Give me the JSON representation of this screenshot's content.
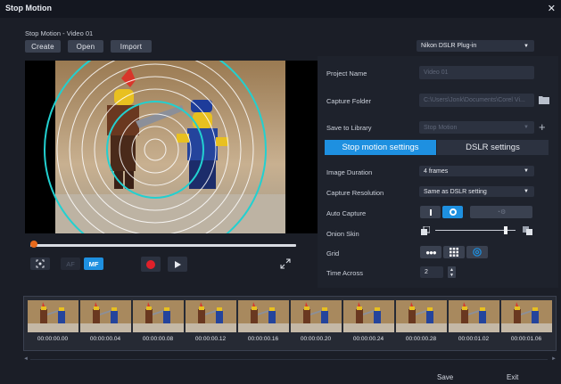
{
  "window": {
    "title": "Stop Motion",
    "subtitle": "Stop Motion - Video 01"
  },
  "toolbar": {
    "create": "Create",
    "open": "Open",
    "import": "Import"
  },
  "plugin_select": "Nikon DSLR Plug-in",
  "fields": {
    "project_name_label": "Project Name",
    "project_name_value": "Video 01",
    "capture_folder_label": "Capture Folder",
    "capture_folder_value": "C:\\Users\\Jonk\\Documents\\Corel Vi...",
    "save_library_label": "Save to Library",
    "save_library_value": "Stop Motion"
  },
  "tabs": {
    "stop_motion": "Stop motion settings",
    "dslr": "DSLR settings"
  },
  "settings": {
    "image_duration_label": "Image Duration",
    "image_duration_value": "4 frames",
    "capture_resolution_label": "Capture Resolution",
    "capture_resolution_value": "Same as DSLR setting",
    "auto_capture_label": "Auto Capture",
    "onion_skin_label": "Onion Skin",
    "grid_label": "Grid",
    "time_across_label": "Time Across",
    "time_across_value": "2",
    "onion_skin_level": 0.88
  },
  "playback": {
    "af": "AF",
    "mf": "MF",
    "progress": 0.0
  },
  "timeline": {
    "timecodes": [
      "00:00:00.00",
      "00:00:00.04",
      "00:00:00.08",
      "00:00:00.12",
      "00:00:00.16",
      "00:00:00.20",
      "00:00:00.24",
      "00:00:00.28",
      "00:00:01.02",
      "00:00:01.06"
    ]
  },
  "footer": {
    "save": "Save",
    "exit": "Exit"
  },
  "colors": {
    "accent": "#1e90e0",
    "record": "#e0202a",
    "cyan_ring": "#22d0d0"
  }
}
